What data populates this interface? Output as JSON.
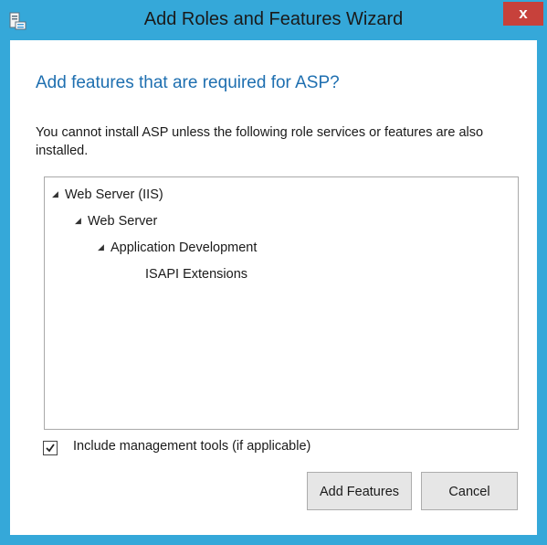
{
  "window": {
    "title": "Add Roles and Features Wizard",
    "close_label": "x",
    "icon": "server-manager-icon"
  },
  "dialog": {
    "heading": "Add features that are required for ASP?",
    "description": "You cannot install ASP unless the following role services or features are also installed.",
    "tree": [
      {
        "label": "Web Server (IIS)",
        "expanded": true,
        "level": 0
      },
      {
        "label": "Web Server",
        "expanded": true,
        "level": 1
      },
      {
        "label": "Application Development",
        "expanded": true,
        "level": 2
      },
      {
        "label": "ISAPI Extensions",
        "expanded": null,
        "level": 3
      }
    ],
    "include_tools": {
      "label": "Include management tools (if applicable)",
      "checked": true
    },
    "buttons": {
      "add_features": "Add Features",
      "cancel": "Cancel"
    }
  },
  "colors": {
    "titlebar": "#35a8d9",
    "close": "#c7413b",
    "heading": "#1e6fb0"
  }
}
